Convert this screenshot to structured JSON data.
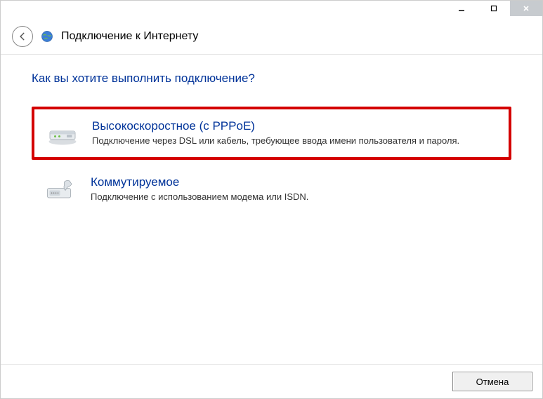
{
  "window": {
    "title": "Подключение к Интернету"
  },
  "question": "Как вы хотите выполнить подключение?",
  "options": [
    {
      "title": "Высокоскоростное (с PPPoE)",
      "desc": "Подключение через DSL или кабель, требующее ввода имени пользователя и пароля."
    },
    {
      "title": "Коммутируемое",
      "desc": "Подключение с использованием модема или ISDN."
    }
  ],
  "buttons": {
    "cancel": "Отмена"
  }
}
